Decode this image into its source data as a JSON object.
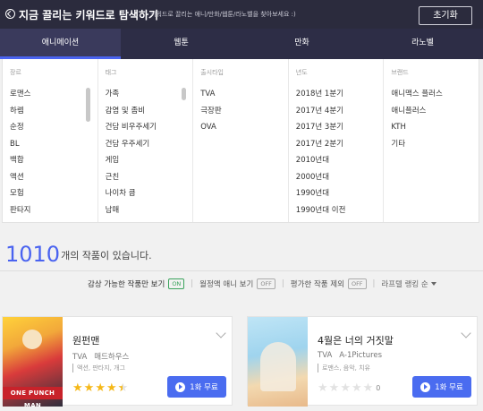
{
  "header": {
    "title": "지금 끌리는 키워드로 탐색하기",
    "hint": "키워드로 끌리는 애니/만화/웹툰/라노벨을 찾아보세요 :)",
    "reset_label": "초기화"
  },
  "tabs": [
    {
      "label": "애니메이션",
      "active": true
    },
    {
      "label": "웹툰",
      "active": false
    },
    {
      "label": "만화",
      "active": false
    },
    {
      "label": "라노벨",
      "active": false
    }
  ],
  "filters": {
    "genre": {
      "heading": "장르",
      "items": [
        "로맨스",
        "하렘",
        "순정",
        "BL",
        "백합",
        "액션",
        "모험",
        "판타지"
      ]
    },
    "tag": {
      "heading": "태그",
      "items": [
        "가족",
        "감염 및 좀비",
        "건담 비우주세기",
        "건담 우주세기",
        "게임",
        "근친",
        "나이차 큼",
        "남매"
      ]
    },
    "type": {
      "heading": "출시타입",
      "items": [
        "TVA",
        "극장판",
        "OVA"
      ]
    },
    "year": {
      "heading": "년도",
      "items": [
        "2018년 1분기",
        "2017년 4분기",
        "2017년 3분기",
        "2017년 2분기",
        "2010년대",
        "2000년대",
        "1990년대",
        "1990년대 이전"
      ]
    },
    "brand": {
      "heading": "브랜드",
      "items": [
        "애니맥스 플러스",
        "애니플러스",
        "KTH",
        "기타"
      ]
    }
  },
  "results": {
    "count": "1010",
    "suffix": "개의 작품이 있습니다."
  },
  "options": {
    "watchable": {
      "label": "감상 가능한 작품만 보기",
      "state": "ON"
    },
    "monthly": {
      "label": "월정액 애니 보기",
      "state": "OFF"
    },
    "exclude_rated": {
      "label": "평가한 작품 제외",
      "state": "OFF"
    },
    "sort": {
      "label": "라프텔 랭킹 순"
    }
  },
  "cards": [
    {
      "title": "원펀맨",
      "type": "TVA",
      "studio": "매드하우스",
      "tags": "액션, 판타지, 개그",
      "poster_text": "ONE PUNCH MAN",
      "rating": 4.5,
      "rating_text": "",
      "button_label": "1화 무료"
    },
    {
      "title": "4월은 너의 거짓말",
      "type": "TVA",
      "studio": "A-1Pictures",
      "tags": "로맨스, 음악, 치유",
      "poster_text": "",
      "rating": 0,
      "rating_text": "0",
      "button_label": "1화 무료"
    }
  ],
  "colors": {
    "header_bg": "#2b2b3d",
    "accent": "#4a63f0",
    "star": "#f5b818",
    "toggle_on": "#3aa35c"
  }
}
